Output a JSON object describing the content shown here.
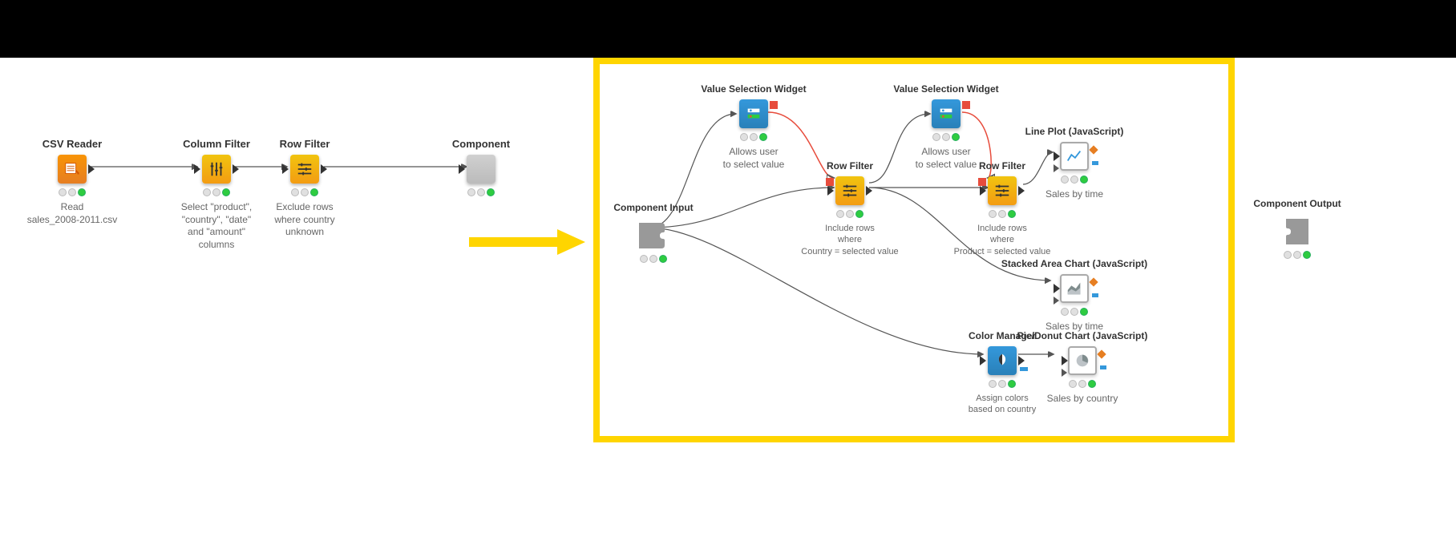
{
  "left": {
    "csvReader": {
      "title": "CSV Reader",
      "desc1": "Read",
      "desc2": "sales_2008-2011.csv"
    },
    "columnFilter": {
      "title": "Column Filter",
      "desc1": "Select \"product\",",
      "desc2": "\"country\", \"date\"",
      "desc3": "and \"amount\"",
      "desc4": "columns"
    },
    "rowFilter": {
      "title": "Row Filter",
      "desc1": "Exclude rows",
      "desc2": "where country",
      "desc3": "unknown"
    },
    "component": {
      "title": "Component"
    }
  },
  "right": {
    "componentInput": {
      "title": "Component Input"
    },
    "valueSel1": {
      "title": "Value Selection Widget",
      "desc1": "Allows user",
      "desc2": "to select value"
    },
    "valueSel2": {
      "title": "Value Selection Widget",
      "desc1": "Allows user",
      "desc2": "to select value"
    },
    "rowFilter1": {
      "title": "Row Filter",
      "desc1": "Include rows",
      "desc2": "where",
      "desc3": "Country = selected value"
    },
    "rowFilter2": {
      "title": "Row Filter",
      "desc1": "Include rows",
      "desc2": "where",
      "desc3": "Product = selected value"
    },
    "linePlot": {
      "title": "Line Plot (JavaScript)",
      "desc1": "Sales by time"
    },
    "stackedArea": {
      "title": "Stacked Area Chart (JavaScript)",
      "desc1": "Sales by time"
    },
    "colorMgr": {
      "title": "Color Manager",
      "desc1": "Assign colors",
      "desc2": "based on country"
    },
    "pieDonut": {
      "title": "Pie/Donut Chart (JavaScript)",
      "desc1": "Sales by country"
    },
    "componentOutput": {
      "title": "Component Output"
    }
  },
  "colors": {
    "highlightYellow": "#ffd500",
    "orange": "#f39c12",
    "teal": "#3498db"
  }
}
